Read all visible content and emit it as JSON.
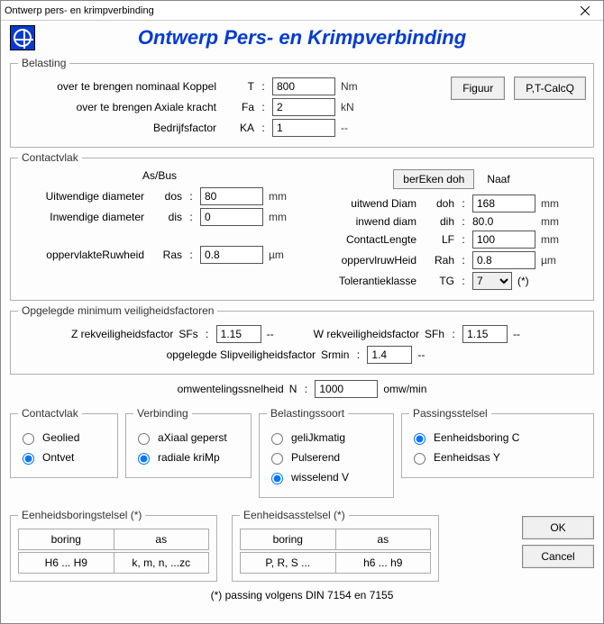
{
  "window": {
    "title": "Ontwerp pers- en krimpverbinding"
  },
  "header": {
    "title": "Ontwerp Pers- en Krimpverbinding"
  },
  "belasting": {
    "legend": "Belasting",
    "koppel_lbl": "over te brengen nominaal Koppel",
    "koppel_sym": "T",
    "koppel_val": "800",
    "koppel_unit": "Nm",
    "axiaal_lbl": "over te brengen Axiale kracht",
    "axiaal_sym": "Fa",
    "axiaal_val": "2",
    "axiaal_unit": "kN",
    "bedrijf_lbl": "Bedrijfsfactor",
    "bedrijf_sym": "KA",
    "bedrijf_val": "1",
    "bedrijf_unit": "--",
    "figuur_btn": "Figuur",
    "ptcalc_btn": "P,T-CalcQ"
  },
  "contactvlak": {
    "legend": "Contactvlak",
    "asbus_hdr": "As/Bus",
    "naaf_hdr": "Naaf",
    "bereken_btn": "berEken  doh",
    "uitw_lbl": "Uitwendige diameter",
    "uitw_sym": "dos",
    "uitw_val": "80",
    "uitw_unit": "mm",
    "inw_lbl": "Inwendige diameter",
    "inw_sym": "dis",
    "inw_val": "0",
    "inw_unit": "mm",
    "ruw_lbl": "oppervlakteRuwheid",
    "ruw_sym": "Ras",
    "ruw_val": "0.8",
    "ruw_unit": "µm",
    "uitwd_lbl": "uitwend Diam",
    "uitwd_sym": "doh",
    "uitwd_val": "168",
    "uitwd_unit": "mm",
    "inwd_lbl": "inwend diam",
    "inwd_sym": "dih",
    "inwd_val": "80.0",
    "inwd_unit": "mm",
    "len_lbl": "ContactLengte",
    "len_sym": "LF",
    "len_val": "100",
    "len_unit": "mm",
    "ruwh_lbl": "oppervlruwHeid",
    "ruwh_sym": "Rah",
    "ruwh_val": "0.8",
    "ruwh_unit": "µm",
    "tol_lbl": "Tolerantieklasse",
    "tol_sym": "TG",
    "tol_val": "7",
    "tol_note": "(*)"
  },
  "veiligheid": {
    "legend": "Opgelegde minimum veiligheidsfactoren",
    "sfs_lbl": "Z rekveiligheidsfactor",
    "sfs_sym": "SFs",
    "sfs_val": "1.15",
    "sfs_unit": "--",
    "sfh_lbl": "W rekveiligheidsfactor",
    "sfh_sym": "SFh",
    "sfh_val": "1.15",
    "sfh_unit": "--",
    "srmin_lbl": "opgelegde Slipveiligheidsfactor",
    "srmin_sym": "Srmin",
    "srmin_val": "1.4",
    "srmin_unit": "--"
  },
  "omw": {
    "lbl": "omwentelingssnelheid",
    "sym": "N",
    "val": "1000",
    "unit": "omw/min"
  },
  "cv2": {
    "legend": "Contactvlak",
    "geolied": "Geolied",
    "ontvet": "Ontvet"
  },
  "verbinding": {
    "legend": "Verbinding",
    "axiaal": "aXiaal geperst",
    "radiaal": "radiale kriMp"
  },
  "belastingssoort": {
    "legend": "Belastingssoort",
    "gelijk": "geliJkmatig",
    "puls": "Pulserend",
    "wissel": "wisselend  V"
  },
  "passing": {
    "legend": "Passingsstelsel",
    "boring": "Eenheidsboring C",
    "as": "Eenheidsas  Y"
  },
  "boringstelsel": {
    "legend": "Eenheidsboringstelsel (*)",
    "hdr_boring": "boring",
    "hdr_as": "as",
    "val_boring": "H6 ... H9",
    "val_as": "k, m, n, ...zc"
  },
  "asstelsel": {
    "legend": "Eenheidsasstelsel (*)",
    "hdr_boring": "boring",
    "hdr_as": "as",
    "val_boring": "P, R, S ...",
    "val_as": "h6 ... h9"
  },
  "footnote": "(*) passing volgens DIN 7154 en 7155",
  "buttons": {
    "ok": "OK",
    "cancel": "Cancel"
  },
  "colon": ":"
}
